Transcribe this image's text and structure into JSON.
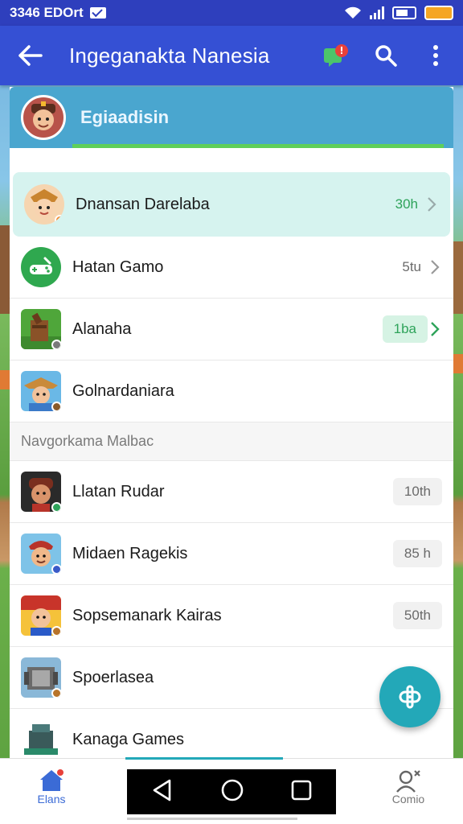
{
  "status_bar": {
    "time": "3346 EDOrt"
  },
  "app_bar": {
    "title": "Ingeganakta Nanesia"
  },
  "sheet": {
    "title": "Egiaadisin"
  },
  "list_top": [
    {
      "label": "Dnansan Darelaba",
      "meta": "30h",
      "style": "green-text",
      "selected": true
    },
    {
      "label": "Hatan Gamo",
      "meta": "5tu",
      "style": "plain"
    },
    {
      "label": "Alanaha",
      "meta": "1ba",
      "style": "green-chip"
    },
    {
      "label": "Golnardaniara",
      "meta": "",
      "style": "none"
    }
  ],
  "section_header": "Navgorkama Malbac",
  "list_bottom": [
    {
      "label": "Llatan Rudar",
      "meta": "10th"
    },
    {
      "label": "Midaen Ragekis",
      "meta": "85 h"
    },
    {
      "label": "Sopsemanark Kairas",
      "meta": "50th"
    },
    {
      "label": "Spoerlasea",
      "meta": ""
    },
    {
      "label": "Kanaga Games",
      "meta": ""
    }
  ],
  "bottom_nav": {
    "home_label": "Elans",
    "game_label": "Comio"
  },
  "colors": {
    "status_bar": "#2e3fbd",
    "app_bar": "#3550d4",
    "sheet_header": "#4aa6cf",
    "accent": "#23a8b8",
    "green": "#2ea35a",
    "selected_row": "#d6f3ef"
  },
  "icons": [
    "mail-icon",
    "wifi-icon",
    "signal-icon",
    "battery-icon",
    "back-arrow-icon",
    "notification-icon",
    "search-icon",
    "more-vert-icon",
    "chevron-right-icon",
    "gamepad-icon",
    "home-icon",
    "profile-icon",
    "back-triangle-icon",
    "home-circle-icon",
    "recents-square-icon"
  ]
}
